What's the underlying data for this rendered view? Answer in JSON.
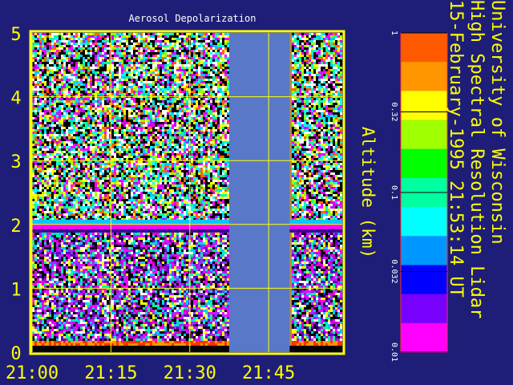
{
  "chart_data": {
    "type": "heatmap",
    "title": "Aerosol Depolarization",
    "ylabel": "Altitude (km)",
    "xlabel": "",
    "y_ticks": [
      "0",
      "1",
      "2",
      "3",
      "4",
      "5"
    ],
    "x_ticks": [
      "21:00",
      "21:15",
      "21:30",
      "21:45"
    ],
    "ylim": [
      0,
      5
    ],
    "x_range_minutes": [
      0,
      59
    ],
    "data_gap_minutes": [
      37.5,
      49
    ],
    "colorbar": {
      "scale": "log",
      "range": [
        0.01,
        1
      ],
      "tick_labels": [
        "1",
        "0.32",
        "0.1",
        "0.032",
        "0.01"
      ],
      "tick_values": [
        1,
        0.32,
        0.1,
        0.032,
        0.01
      ]
    },
    "features": {
      "boundary_layer_top_km": 2.0,
      "surface_layer_km": [
        0,
        0.2
      ]
    },
    "info": [
      "University of Wisconsin",
      "High Spectral Resolution Lidar",
      "15-February-1995 21:53:14 UT"
    ],
    "colors": {
      "background": "#1e1e78",
      "axes": "#ffff00",
      "gap": "#5a78c8"
    }
  }
}
